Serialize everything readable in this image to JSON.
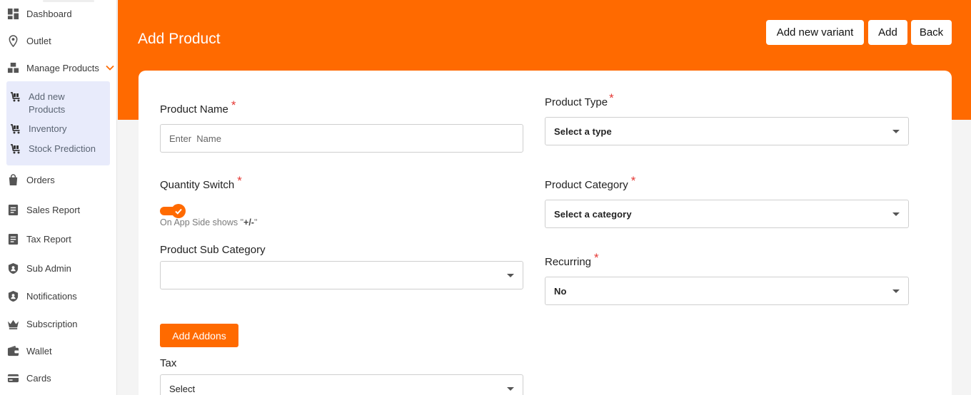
{
  "sidebar": {
    "items": [
      {
        "label": "Dashboard",
        "icon": "dashboard-icon"
      },
      {
        "label": "Outlet",
        "icon": "location-pin-icon"
      },
      {
        "label": "Manage Products",
        "icon": "boxes-icon"
      },
      {
        "label": "Orders",
        "icon": "shopping-bag-icon"
      },
      {
        "label": "Sales Report",
        "icon": "report-icon"
      },
      {
        "label": "Tax Report",
        "icon": "report-icon"
      },
      {
        "label": "Sub Admin",
        "icon": "shield-user-icon"
      },
      {
        "label": "Notifications",
        "icon": "shield-user-icon"
      },
      {
        "label": "Subscription",
        "icon": "crown-icon"
      },
      {
        "label": "Wallet",
        "icon": "wallet-icon"
      },
      {
        "label": "Cards",
        "icon": "card-icon"
      }
    ],
    "submenu": [
      {
        "line1": "Add new",
        "line2": "Products",
        "icon": "cart-icon"
      },
      {
        "line1": "Inventory",
        "icon": "cart-icon"
      },
      {
        "line1": "Stock Prediction",
        "icon": "cart-icon"
      }
    ]
  },
  "header": {
    "title": "Add Product",
    "buttons": {
      "add_variant": "Add new variant",
      "add": "Add",
      "back": "Back"
    }
  },
  "form": {
    "product_name": {
      "label": "Product Name",
      "placeholder": "Enter  Name",
      "required_mark": "*"
    },
    "product_type": {
      "label": "Product Type",
      "value": "Select a type",
      "required_mark": "*"
    },
    "quantity_switch": {
      "label": "Quantity Switch",
      "required_mark": "*",
      "on": true,
      "hint_prefix": "On App Side shows \"",
      "hint_symbol": "+/-",
      "hint_suffix": "\""
    },
    "product_category": {
      "label": "Product Category",
      "value": "Select a category",
      "required_mark": "*"
    },
    "product_sub_category": {
      "label": "Product Sub Category",
      "value": ""
    },
    "recurring": {
      "label": "Recurring",
      "value": "No",
      "required_mark": "*"
    },
    "add_addons": "Add Addons",
    "tax": {
      "label": "Tax",
      "value": "Select"
    }
  },
  "colors": {
    "accent": "#ff6a00",
    "required": "#e53935",
    "submenu_bg": "#e8ebfb"
  }
}
